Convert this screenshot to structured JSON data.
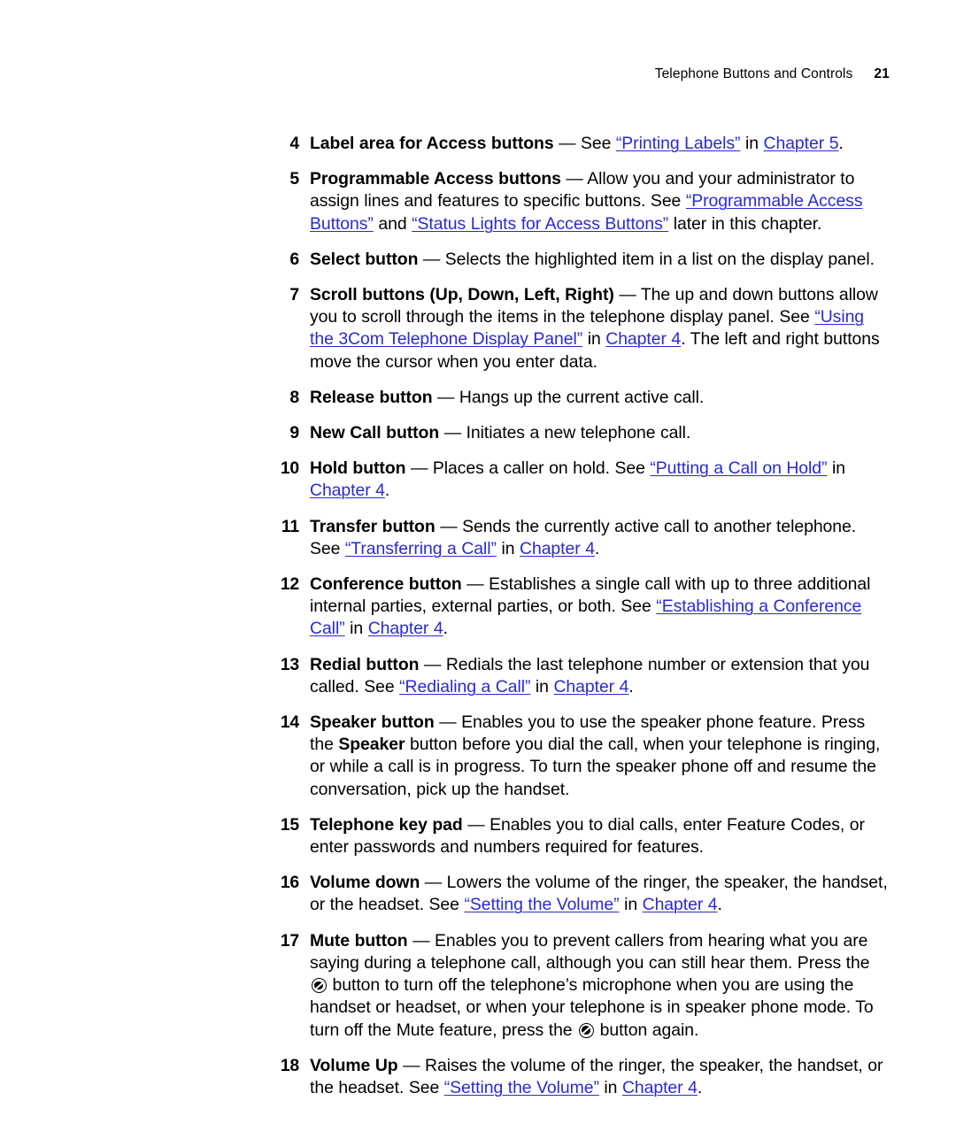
{
  "header": {
    "title": "Telephone Buttons and Controls",
    "page_number": "21"
  },
  "colors": {
    "link": "#2a2ad0",
    "text": "#000000",
    "page_background": "#ffffff"
  },
  "icons": {
    "mute_glyph_name": "mute-icon"
  },
  "list": {
    "items": [
      {
        "number": "4",
        "term": "Label area for Access buttons",
        "dash": " — ",
        "segments": [
          {
            "type": "text",
            "value": "See "
          },
          {
            "type": "link",
            "value": "“Printing Labels”"
          },
          {
            "type": "text",
            "value": " in "
          },
          {
            "type": "link",
            "value": "Chapter 5"
          },
          {
            "type": "text",
            "value": "."
          }
        ]
      },
      {
        "number": "5",
        "term": "Programmable Access buttons",
        "dash": " — ",
        "segments": [
          {
            "type": "text",
            "value": "Allow you and your administrator to assign lines and features to specific buttons. See "
          },
          {
            "type": "link",
            "value": "“Programmable Access Buttons”"
          },
          {
            "type": "text",
            "value": " and "
          },
          {
            "type": "link",
            "value": "“Status Lights for Access Buttons”"
          },
          {
            "type": "text",
            "value": " later in this chapter."
          }
        ]
      },
      {
        "number": "6",
        "term": "Select button",
        "dash": " — ",
        "segments": [
          {
            "type": "text",
            "value": "Selects the highlighted item in a list on the display panel."
          }
        ]
      },
      {
        "number": "7",
        "term": "Scroll buttons (Up, Down, Left, Right)",
        "dash": " — ",
        "segments": [
          {
            "type": "text",
            "value": "The up and down buttons allow you to scroll through the items in the telephone display panel. See "
          },
          {
            "type": "link",
            "value": "“Using the 3Com Telephone Display Panel”"
          },
          {
            "type": "text",
            "value": " in "
          },
          {
            "type": "link",
            "value": "Chapter 4"
          },
          {
            "type": "text",
            "value": ". The left and right buttons move the cursor when you enter data."
          }
        ]
      },
      {
        "number": "8",
        "term": "Release button",
        "dash": " — ",
        "segments": [
          {
            "type": "text",
            "value": "Hangs up the current active call."
          }
        ]
      },
      {
        "number": "9",
        "term": "New Call button",
        "dash": " — ",
        "segments": [
          {
            "type": "text",
            "value": "Initiates a new telephone call."
          }
        ]
      },
      {
        "number": "10",
        "term": "Hold button",
        "dash": " — ",
        "segments": [
          {
            "type": "text",
            "value": "Places a caller on hold. See "
          },
          {
            "type": "link",
            "value": "“Putting a Call on Hold”"
          },
          {
            "type": "text",
            "value": " in "
          },
          {
            "type": "link",
            "value": "Chapter 4"
          },
          {
            "type": "text",
            "value": "."
          }
        ]
      },
      {
        "number": "11",
        "term": "Transfer button",
        "dash": " — ",
        "segments": [
          {
            "type": "text",
            "value": "Sends the currently active call to another telephone. See "
          },
          {
            "type": "link",
            "value": "“Transferring a Call”"
          },
          {
            "type": "text",
            "value": " in "
          },
          {
            "type": "link",
            "value": "Chapter 4"
          },
          {
            "type": "text",
            "value": "."
          }
        ]
      },
      {
        "number": "12",
        "term": "Conference button",
        "dash": " — ",
        "segments": [
          {
            "type": "text",
            "value": "Establishes a single call with up to three additional internal parties, external parties, or both. See "
          },
          {
            "type": "link",
            "value": "“Establishing a Conference Call”"
          },
          {
            "type": "text",
            "value": " in "
          },
          {
            "type": "link",
            "value": "Chapter 4"
          },
          {
            "type": "text",
            "value": "."
          }
        ]
      },
      {
        "number": "13",
        "term": "Redial button",
        "dash": " — ",
        "segments": [
          {
            "type": "text",
            "value": "Redials the last telephone number or extension that you called. See "
          },
          {
            "type": "link",
            "value": "“Redialing a Call”"
          },
          {
            "type": "text",
            "value": " in "
          },
          {
            "type": "link",
            "value": "Chapter 4"
          },
          {
            "type": "text",
            "value": "."
          }
        ]
      },
      {
        "number": "14",
        "term": "Speaker button",
        "dash": " — ",
        "segments": [
          {
            "type": "text",
            "value": "Enables you to use the speaker phone feature. Press the "
          },
          {
            "type": "bold",
            "value": "Speaker"
          },
          {
            "type": "text",
            "value": " button before you dial the call, when your telephone is ringing, or while a call is in progress. To turn the speaker phone off and resume the conversation, pick up the handset."
          }
        ]
      },
      {
        "number": "15",
        "term": "Telephone key pad",
        "dash": " — ",
        "segments": [
          {
            "type": "text",
            "value": "Enables you to dial calls, enter Feature Codes, or enter passwords and numbers required for features."
          }
        ]
      },
      {
        "number": "16",
        "term": "Volume down",
        "dash": " — ",
        "segments": [
          {
            "type": "text",
            "value": "Lowers the volume of the ringer, the speaker, the handset, or the headset. See "
          },
          {
            "type": "link",
            "value": "“Setting the Volume”"
          },
          {
            "type": "text",
            "value": " in "
          },
          {
            "type": "link",
            "value": "Chapter 4"
          },
          {
            "type": "text",
            "value": "."
          }
        ]
      },
      {
        "number": "17",
        "term": "Mute button",
        "dash": " — ",
        "segments": [
          {
            "type": "text",
            "value": "Enables you to prevent callers from hearing what you are saying during a telephone call, although you can still hear them. Press the "
          },
          {
            "type": "icon",
            "value": "mute-icon"
          },
          {
            "type": "text",
            "value": " button to turn off the telephone’s microphone when you are using the handset or headset, or when your telephone is in speaker phone mode. To turn off the Mute feature, press the "
          },
          {
            "type": "icon",
            "value": "mute-icon"
          },
          {
            "type": "text",
            "value": " button again."
          }
        ]
      },
      {
        "number": "18",
        "term": "Volume Up",
        "dash": " — ",
        "segments": [
          {
            "type": "text",
            "value": "Raises the volume of the ringer, the speaker, the handset, or the headset. See "
          },
          {
            "type": "link",
            "value": "“Setting the Volume”"
          },
          {
            "type": "text",
            "value": " in "
          },
          {
            "type": "link",
            "value": "Chapter 4"
          },
          {
            "type": "text",
            "value": "."
          }
        ]
      }
    ]
  }
}
